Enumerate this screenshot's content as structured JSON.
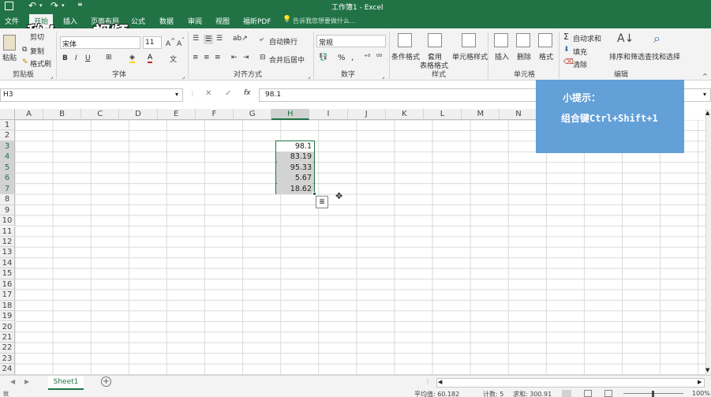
{
  "window": {
    "title": "工作簿1 - Excel"
  },
  "tell_me": "告诉我您想要做什么...",
  "tabs": [
    "文件",
    "开始",
    "插入",
    "页面布局",
    "公式",
    "数据",
    "审阅",
    "视图",
    "福昕PDF"
  ],
  "watermark": "秒dong视频",
  "ribbon": {
    "paste": "粘贴",
    "cut": "剪切",
    "copy": "复制",
    "format_painter": "格式刷",
    "font_name": "宋体",
    "font_size": "11",
    "wrap_text": "自动换行",
    "merge_center": "合并后居中",
    "number_format": "常规",
    "percent": "%",
    "comma": ",",
    "conditional_format": "条件格式",
    "table_format_1": "套用",
    "table_format_2": "表格格式",
    "cell_styles": "单元格样式",
    "insert": "插入",
    "delete": "删除",
    "format": "格式",
    "autosum": "自动求和",
    "fill": "填充",
    "clear": "清除",
    "sort_filter": "排序和筛选",
    "find_select": "查找和选择",
    "groups": {
      "clipboard": "剪贴板",
      "font": "字体",
      "alignment": "对齐方式",
      "number": "数字",
      "styles": "样式",
      "cells": "单元格",
      "editing": "编辑"
    }
  },
  "formula_bar": {
    "name_box": "H3",
    "fx": "fx",
    "value": "98.1"
  },
  "columns": [
    "A",
    "B",
    "C",
    "D",
    "E",
    "F",
    "G",
    "H",
    "I",
    "J",
    "K",
    "L",
    "M",
    "N"
  ],
  "rows": [
    "1",
    "2",
    "3",
    "4",
    "5",
    "6",
    "7",
    "8",
    "9",
    "10",
    "11",
    "12",
    "13",
    "14",
    "15",
    "16",
    "17",
    "18",
    "19",
    "20",
    "21",
    "22",
    "23",
    "24"
  ],
  "cells": [
    "98.1",
    "83.19",
    "95.33",
    "5.67",
    "18.62"
  ],
  "tip": {
    "title": "小提示：",
    "text": "组合键Ctrl+Shift+1"
  },
  "sheet_tab": "Sheet1",
  "status": {
    "average": "平均值: 60.182",
    "count": "计数: 5",
    "sum": "求和: 300.91",
    "zoom": "100%"
  }
}
